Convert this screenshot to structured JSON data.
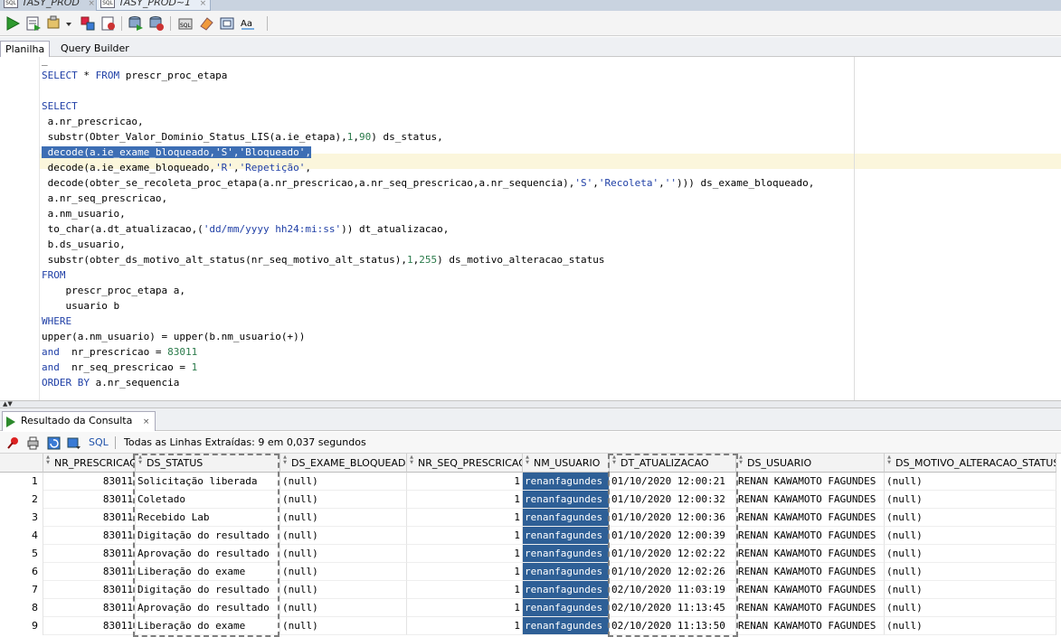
{
  "doc_tabs": [
    {
      "label": "TASY_PROD",
      "close": "×"
    },
    {
      "label": "TASY_PROD~1",
      "close": "×"
    }
  ],
  "doc_tab_icon": "SQL",
  "editor_tabs": {
    "worksheet": "Planilha",
    "query_builder": "Query Builder"
  },
  "editor": {
    "lines": [
      {
        "t": "_",
        "y": 0
      },
      {
        "t": "SELECT * FROM prescr_proc_etapa",
        "y": 1
      },
      {
        "t": "",
        "y": 2
      },
      {
        "t": "SELECT",
        "y": 3
      },
      {
        "t": " a.nr_prescricao,",
        "y": 4
      },
      {
        "t": " substr(Obter_Valor_Dominio_Status_LIS(a.ie_etapa),1,90) ds_status,",
        "y": 5
      },
      {
        "t": " decode(a.ie_exame_bloqueado,'S','Bloqueado',",
        "y": 6
      },
      {
        "t": " decode(a.ie_exame_bloqueado,'R','Repetição',",
        "y": 7
      },
      {
        "t": " decode(obter_se_recoleta_proc_etapa(a.nr_prescricao,a.nr_seq_prescricao,a.nr_sequencia),'S','Recoleta',''))) ds_exame_bloqueado,",
        "y": 8
      },
      {
        "t": " a.nr_seq_prescricao,",
        "y": 9
      },
      {
        "t": " a.nm_usuario,",
        "y": 10
      },
      {
        "t": " to_char(a.dt_atualizacao,('dd/mm/yyyy hh24:mi:ss')) dt_atualizacao,",
        "y": 11
      },
      {
        "t": " b.ds_usuario,",
        "y": 12
      },
      {
        "t": " substr(obter_ds_motivo_alt_status(nr_seq_motivo_alt_status),1,255) ds_motivo_alteracao_status",
        "y": 13
      },
      {
        "t": "FROM",
        "y": 14
      },
      {
        "t": "    prescr_proc_etapa a,",
        "y": 15
      },
      {
        "t": "    usuario b",
        "y": 16
      },
      {
        "t": "WHERE",
        "y": 17
      },
      {
        "t": "upper(a.nm_usuario) = upper(b.nm_usuario(+))",
        "y": 18
      },
      {
        "t": "and  nr_prescricao = 83011",
        "y": 19
      },
      {
        "t": "and  nr_seq_prescricao = 1",
        "y": 20
      },
      {
        "t": "ORDER BY a.nr_sequencia",
        "y": 21
      }
    ]
  },
  "results": {
    "tab_label": "Resultado da Consulta",
    "tab_close": "×",
    "sql_link": "SQL",
    "status": "Todas as Linhas Extraídas: 9 em 0,037 segundos",
    "columns": [
      "NR_PRESCRICAO",
      "DS_STATUS",
      "DS_EXAME_BLOQUEADO",
      "NR_SEQ_PRESCRICAO",
      "NM_USUARIO",
      "DT_ATUALIZACAO",
      "DS_USUARIO",
      "DS_MOTIVO_ALTERACAO_STATUS"
    ],
    "rows": [
      [
        "1",
        "83011",
        "Solicitação liberada",
        "(null)",
        "1",
        "renanfagundes",
        "01/10/2020 12:00:21",
        "RENAN KAWAMOTO FAGUNDES",
        "(null)"
      ],
      [
        "2",
        "83011",
        "Coletado",
        "(null)",
        "1",
        "renanfagundes",
        "01/10/2020 12:00:32",
        "RENAN KAWAMOTO FAGUNDES",
        "(null)"
      ],
      [
        "3",
        "83011",
        "Recebido Lab",
        "(null)",
        "1",
        "renanfagundes",
        "01/10/2020 12:00:36",
        "RENAN KAWAMOTO FAGUNDES",
        "(null)"
      ],
      [
        "4",
        "83011",
        "Digitação do resultado",
        "(null)",
        "1",
        "renanfagundes",
        "01/10/2020 12:00:39",
        "RENAN KAWAMOTO FAGUNDES",
        "(null)"
      ],
      [
        "5",
        "83011",
        "Aprovação do resultado",
        "(null)",
        "1",
        "renanfagundes",
        "01/10/2020 12:02:22",
        "RENAN KAWAMOTO FAGUNDES",
        "(null)"
      ],
      [
        "6",
        "83011",
        "Liberação do exame",
        "(null)",
        "1",
        "renanfagundes",
        "01/10/2020 12:02:26",
        "RENAN KAWAMOTO FAGUNDES",
        "(null)"
      ],
      [
        "7",
        "83011",
        "Digitação do resultado",
        "(null)",
        "1",
        "renanfagundes",
        "02/10/2020 11:03:19",
        "RENAN KAWAMOTO FAGUNDES",
        "(null)"
      ],
      [
        "8",
        "83011",
        "Aprovação do resultado",
        "(null)",
        "1",
        "renanfagundes",
        "02/10/2020 11:13:45",
        "RENAN KAWAMOTO FAGUNDES",
        "(null)"
      ],
      [
        "9",
        "83011",
        "Liberação do exame",
        "(null)",
        "1",
        "renanfagundes",
        "02/10/2020 11:13:50",
        "RENAN KAWAMOTO FAGUNDES",
        "(null)"
      ]
    ]
  },
  "colors": {
    "keyword": "#1f3fa6",
    "selection": "#3d6eb4",
    "cell_selected": "#2e5f96",
    "current_line": "#fbf6dc"
  }
}
